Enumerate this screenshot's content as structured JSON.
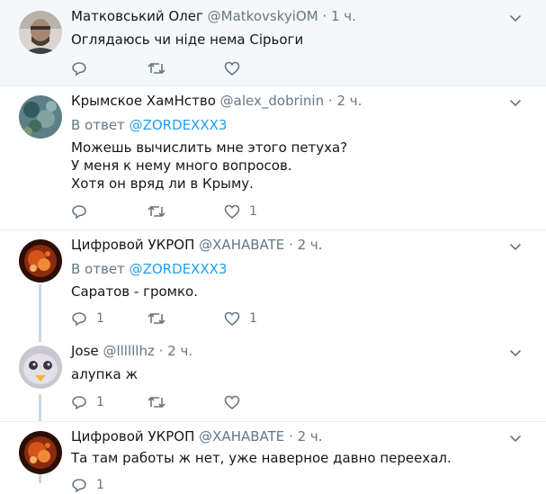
{
  "colors": {
    "link": "#1da1f2",
    "muted": "#657786",
    "divider": "#e6ecf0",
    "highlight_bg": "#f5f8fa"
  },
  "tweets": [
    {
      "name": "Матковський Олег",
      "handle": "@MatkovskyiOM",
      "time": "1 ч.",
      "dot": "·",
      "text_lines": [
        "Оглядаюсь чи ніде нема Сірьоги"
      ],
      "reply_count": "",
      "like_count": ""
    },
    {
      "name": "Крымское ХамНство",
      "handle": "@alex_dobrinin",
      "time": "2 ч.",
      "dot": "·",
      "reply_prefix": "В ответ ",
      "reply_mention": "@ZORDEXXX3",
      "text_lines": [
        "Можешь вычислить мне этого петуха?",
        "У меня к нему много вопросов.",
        "Хотя он вряд ли в Крыму."
      ],
      "reply_count": "",
      "like_count": "1"
    },
    {
      "name": "Цифровой УКРОП",
      "handle": "@XAHABATE",
      "time": "2 ч.",
      "dot": "·",
      "reply_prefix": "В ответ ",
      "reply_mention": "@ZORDEXXX3",
      "text_lines": [
        "Саратов - громко."
      ],
      "reply_count": "1",
      "like_count": "1"
    },
    {
      "name": "Jose",
      "handle": "@llllllhz",
      "time": "2 ч.",
      "dot": "·",
      "text_lines": [
        "алупка ж"
      ],
      "reply_count": "1",
      "like_count": ""
    },
    {
      "name": "Цифровой УКРОП",
      "handle": "@XAHABATE",
      "time": "2 ч.",
      "dot": "·",
      "text_lines": [
        "Та там работы ж нет, уже наверное давно переехал."
      ],
      "reply_count": "1",
      "like_count": ""
    }
  ]
}
